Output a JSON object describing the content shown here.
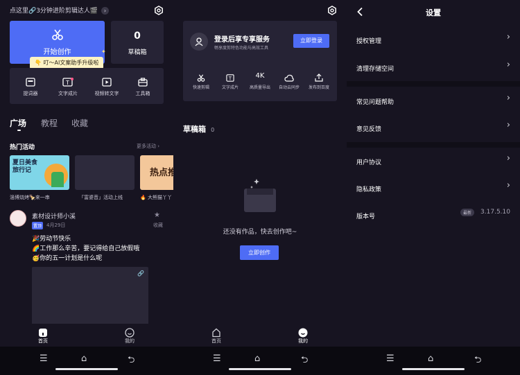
{
  "s1": {
    "promo": "点这里🔗3分钟进阶剪辑达人🎬",
    "start": "开始创作",
    "drafts_count": "0",
    "drafts_label": "草稿箱",
    "tooltip": "👇 叮～AI文案助手升级啦",
    "tools": [
      "提词器",
      "文字成片",
      "视频转文字",
      "工具箱"
    ],
    "tabs": [
      "广场",
      "教程",
      "收藏"
    ],
    "hot": "热门活动",
    "more": "更多活动 ›",
    "banners": [
      {
        "title": "夏日美食\n旅行记",
        "sub": "淄博烧烤🍢来一串"
      },
      {
        "title": "",
        "sub": "「富婆音」活动上线"
      },
      {
        "title": "热点推",
        "sub": "🔥 大熊猫丫丫"
      }
    ],
    "post": {
      "author": "素材设计师小溪",
      "badge": "置顶",
      "date": "4月29日",
      "fav": "收藏",
      "line1": "🎉劳动节快乐",
      "line2": "🌈工作那么辛苦，要记得给自己放假哦",
      "line3": "🥳你的五一计划是什么呢"
    },
    "nav": [
      "首页",
      "我的"
    ]
  },
  "s2": {
    "login_title": "登录后享专享服务",
    "login_sub": "畅享度剪特色功能与高效工具",
    "login_btn": "立即登录",
    "tools": [
      "快速剪辑",
      "文字成片",
      "高质量导出",
      "自动云同步",
      "发布到百度"
    ],
    "drafts": "草稿箱",
    "drafts_count": "0",
    "empty": "还没有作品，快去创作吧~",
    "create_btn": "立即创作",
    "nav": [
      "首页",
      "我的"
    ]
  },
  "s3": {
    "title": "设置",
    "items": [
      "授权管理",
      "清理存储空间",
      "常见问题帮助",
      "意见反馈",
      "用户协议",
      "隐私政策"
    ],
    "version_label": "版本号",
    "version_badge": "最新",
    "version": "3.17.5.10"
  }
}
